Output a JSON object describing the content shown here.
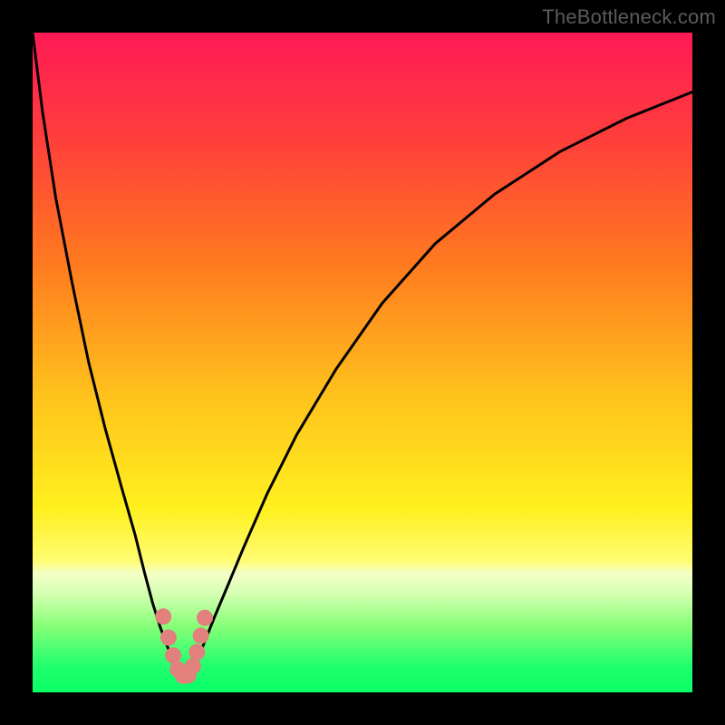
{
  "credit": "TheBottleneck.com",
  "chart_data": {
    "type": "line",
    "title": "",
    "xlabel": "",
    "ylabel": "",
    "xlim": [
      0,
      100
    ],
    "ylim": [
      0,
      100
    ],
    "background_gradient_stops": [
      {
        "offset": 0,
        "color": "#ff1a55"
      },
      {
        "offset": 16,
        "color": "#ff3e3b"
      },
      {
        "offset": 35,
        "color": "#ff7a1f"
      },
      {
        "offset": 55,
        "color": "#ffc21c"
      },
      {
        "offset": 72,
        "color": "#fff01e"
      },
      {
        "offset": 80,
        "color": "#fffc70"
      },
      {
        "offset": 82,
        "color": "#f4ffc8"
      },
      {
        "offset": 85,
        "color": "#d6ffb2"
      },
      {
        "offset": 90,
        "color": "#86ff78"
      },
      {
        "offset": 96,
        "color": "#20ff6e"
      },
      {
        "offset": 100,
        "color": "#08ff66"
      }
    ],
    "series": [
      {
        "name": "left-branch",
        "stroke": "#000000",
        "x": [
          0,
          1.5,
          3.5,
          6,
          8.5,
          11,
          13.5,
          15.5,
          17,
          18.2,
          19.3,
          20.3,
          21.1,
          21.7
        ],
        "y": [
          100,
          88,
          75,
          62,
          50,
          40,
          31,
          24,
          18,
          13.5,
          10,
          7.3,
          5.2,
          4
        ]
      },
      {
        "name": "right-branch",
        "stroke": "#000000",
        "x": [
          24.5,
          25.2,
          26.2,
          27.6,
          29.5,
          32,
          35.5,
          40,
          46,
          53,
          61,
          70,
          80,
          90,
          100
        ],
        "y": [
          4,
          5.5,
          8,
          11.5,
          16,
          22,
          30,
          39,
          49,
          59,
          68,
          75.5,
          82,
          87,
          91
        ]
      },
      {
        "name": "valley",
        "stroke": "#000000",
        "x": [
          21.7,
          22.3,
          22.9,
          23.4,
          23.9,
          24.5
        ],
        "y": [
          4,
          2.7,
          2.1,
          2.1,
          2.7,
          4
        ]
      }
    ],
    "markers": {
      "name": "valley-markers",
      "color": "#e1807c",
      "radius_px": 9,
      "points": [
        {
          "x": 19.8,
          "y": 11.5
        },
        {
          "x": 20.6,
          "y": 8.3
        },
        {
          "x": 21.3,
          "y": 5.6
        },
        {
          "x": 22.0,
          "y": 3.5
        },
        {
          "x": 22.8,
          "y": 2.5
        },
        {
          "x": 23.6,
          "y": 2.6
        },
        {
          "x": 24.3,
          "y": 4.0
        },
        {
          "x": 24.9,
          "y": 6.1
        },
        {
          "x": 25.5,
          "y": 8.6
        },
        {
          "x": 26.1,
          "y": 11.3
        }
      ]
    },
    "grid": false,
    "legend": false
  }
}
